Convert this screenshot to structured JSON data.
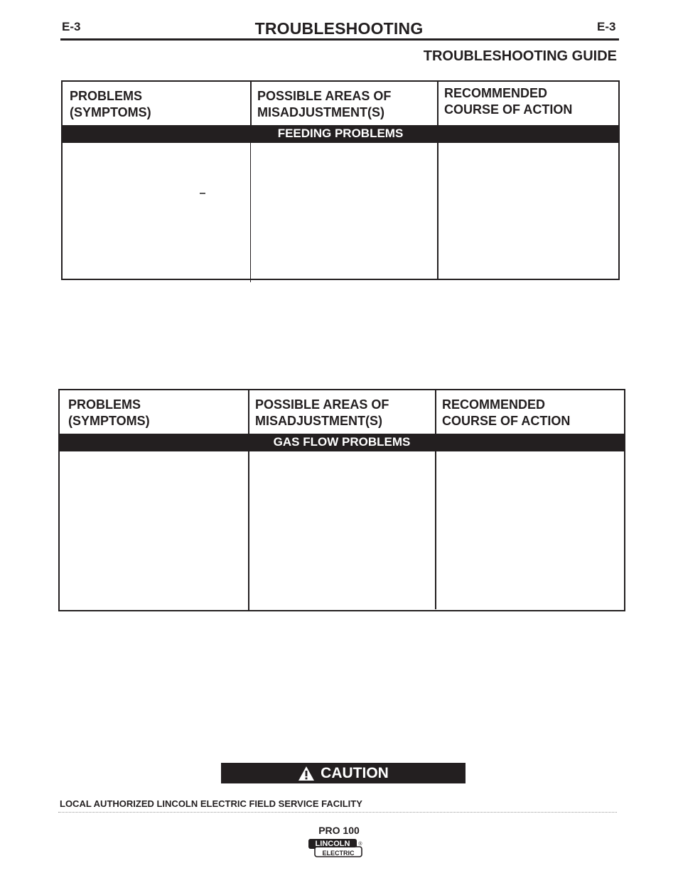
{
  "header": {
    "page_code_left": "E-3",
    "page_code_right": "E-3",
    "title": "TROUBLESHOOTING",
    "section_title": "TROUBLESHOOTING GUIDE"
  },
  "tables": [
    {
      "columns": [
        "PROBLEMS\n(SYMPTOMS)",
        "POSSIBLE AREAS OF\nMISADJUSTMENT(S)",
        "RECOMMENDED\nCOURSE OF ACTION"
      ],
      "band": "FEEDING PROBLEMS",
      "rows": [],
      "stray_mark": "–"
    },
    {
      "columns": [
        "PROBLEMS\n(SYMPTOMS)",
        "POSSIBLE AREAS OF\nMISADJUSTMENT(S)",
        "RECOMMENDED\nCOURSE OF ACTION"
      ],
      "band": "GAS FLOW PROBLEMS",
      "rows": []
    }
  ],
  "caution": {
    "icon": "warning-triangle-icon",
    "label": "CAUTION"
  },
  "footer": {
    "facility": "LOCAL AUTHORIZED LINCOLN ELECTRIC FIELD SERVICE FACILITY",
    "model": "PRO 100",
    "logo_top": "LINCOLN",
    "logo_bottom": "ELECTRIC",
    "logo_mark": "®"
  }
}
